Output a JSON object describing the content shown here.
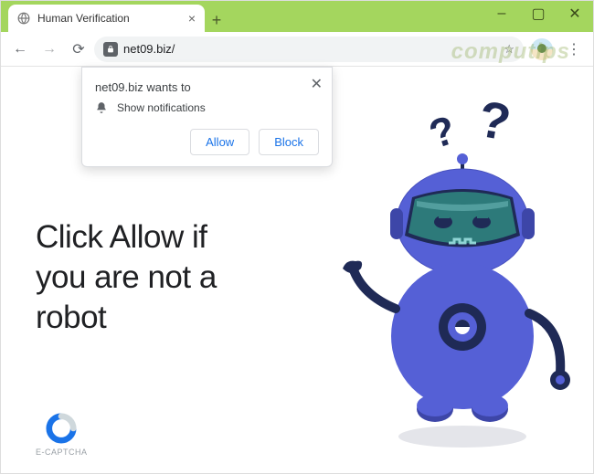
{
  "window": {
    "tab_title": "Human Verification",
    "minimize_glyph": "–",
    "maximize_glyph": "▢",
    "close_glyph": "✕"
  },
  "toolbar": {
    "address": "net09.biz/",
    "back_glyph": "←",
    "forward_glyph": "→",
    "reload_glyph": "⟳",
    "star_glyph": "☆",
    "menu_glyph": "⋮"
  },
  "prompt": {
    "site_text": "net09.biz wants to",
    "permission_text": "Show notifications",
    "allow": "Allow",
    "block": "Block",
    "close_glyph": "✕"
  },
  "page": {
    "headline_l1": "Click Allow if",
    "headline_l2": "you are not a",
    "headline_l3": "robot",
    "logo_text": "E-CAPTCHA",
    "watermark": "computips"
  },
  "robot": {
    "q1": "?",
    "q2": "?"
  }
}
